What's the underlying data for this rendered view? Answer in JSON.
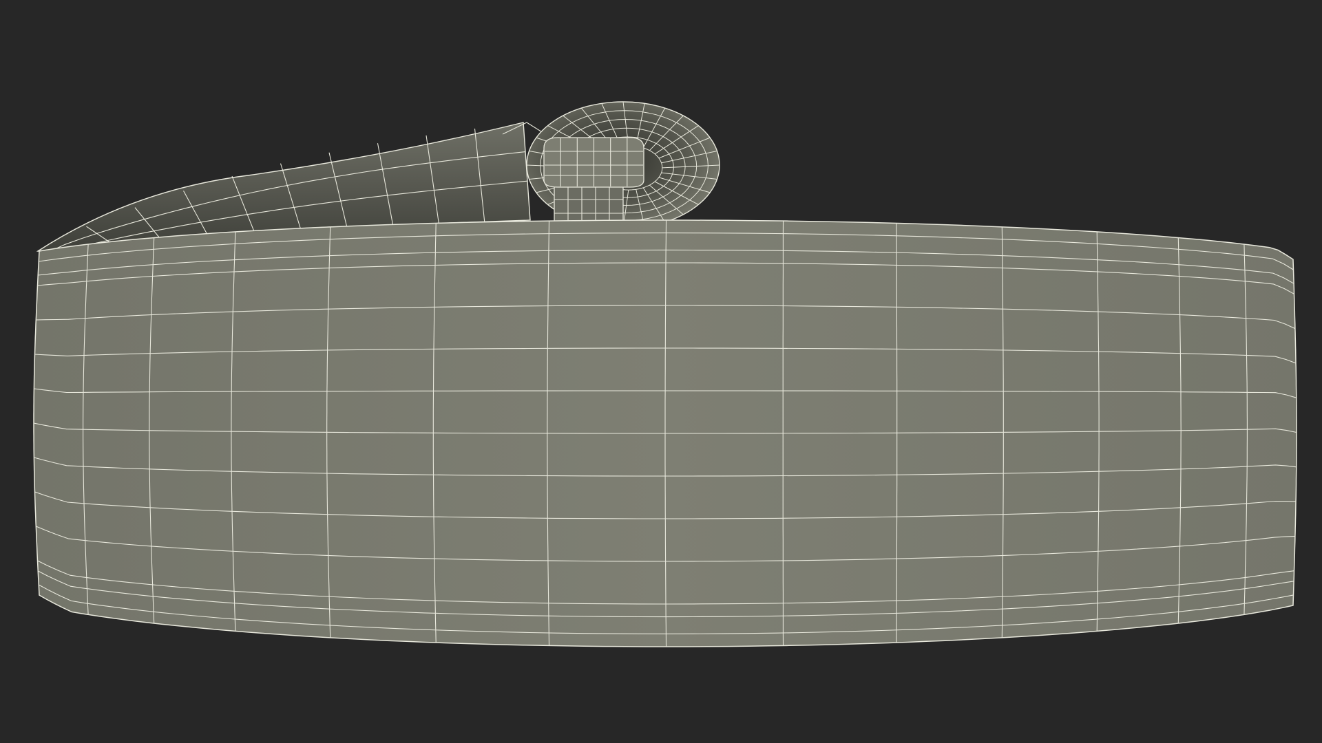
{
  "viewport": {
    "background_color": "#272727",
    "subject": "wireframe-3d-model",
    "colors": {
      "surface_front": "#7c7d70",
      "surface_shadow": "#5a5b51",
      "surface_dark": "#3f403a",
      "wire": "#e8e8dc"
    },
    "grid": {
      "front_face_columns": 14,
      "front_face_rows": 10,
      "strap_segments": 10,
      "ring_segments": 28,
      "ring_layers": 5
    }
  }
}
